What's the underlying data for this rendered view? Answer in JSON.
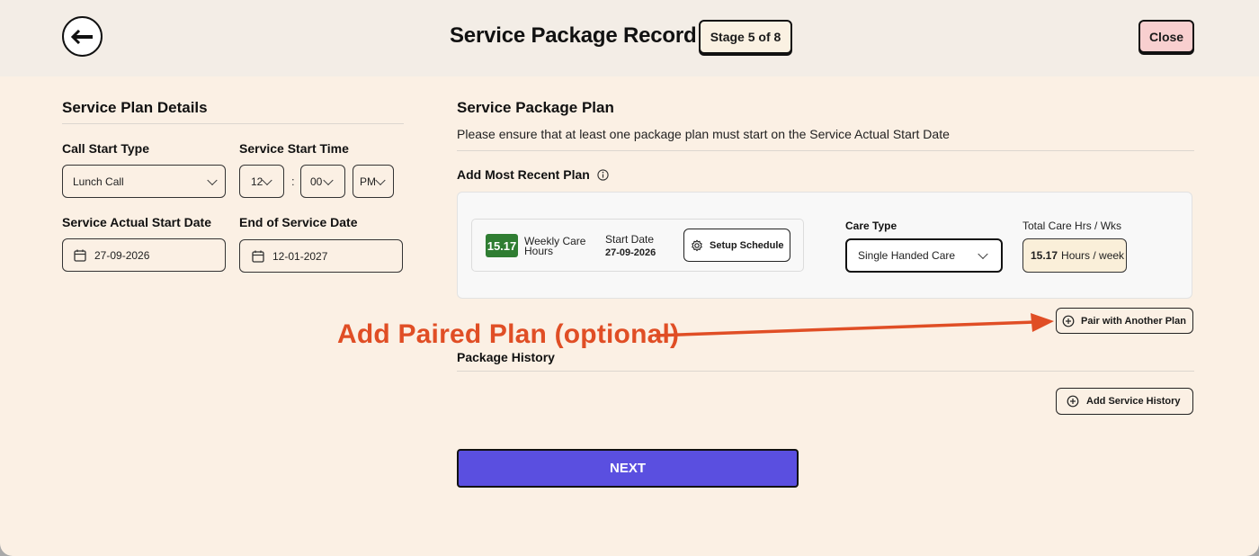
{
  "header": {
    "title": "Service Package Record",
    "stage": "Stage 5 of 8",
    "close_label": "Close"
  },
  "left": {
    "section_title": "Service Plan Details",
    "call_start_type_label": "Call Start Type",
    "call_start_type_value": "Lunch Call",
    "service_start_time_label": "Service Start Time",
    "hour": "12",
    "minute": "00",
    "ampm": "PM",
    "colon": ":",
    "actual_start_label": "Service Actual Start Date",
    "actual_start_value": "27-09-2026",
    "end_label": "End of Service Date",
    "end_value": "12-01-2027"
  },
  "right": {
    "section_title": "Service Package Plan",
    "note": "Please ensure that at least one package plan must start on the Service Actual Start Date",
    "add_recent_label": "Add Most Recent Plan",
    "plan": {
      "hours": "15.17",
      "weekly_label_1": "Weekly Care",
      "weekly_label_2": "Hours",
      "start_date_label": "Start Date",
      "start_date_value": "27-09-2026",
      "setup_schedule_label": "Setup Schedule",
      "care_type_label": "Care Type",
      "care_type_value": "Single Handed Care",
      "total_label": "Total Care Hrs / Wks",
      "total_hours": "15.17",
      "total_unit": "Hours / week"
    },
    "pair_label": "Pair with Another Plan",
    "annotation": "Add Paired Plan (optional)",
    "history_title": "Package History",
    "add_history_label": "Add Service History"
  },
  "next_label": "NEXT",
  "colors": {
    "accent": "#5a4fe0",
    "annotation": "#e04e25",
    "hours_chip": "#2f7d32",
    "close_bg": "#f8cfcf"
  }
}
